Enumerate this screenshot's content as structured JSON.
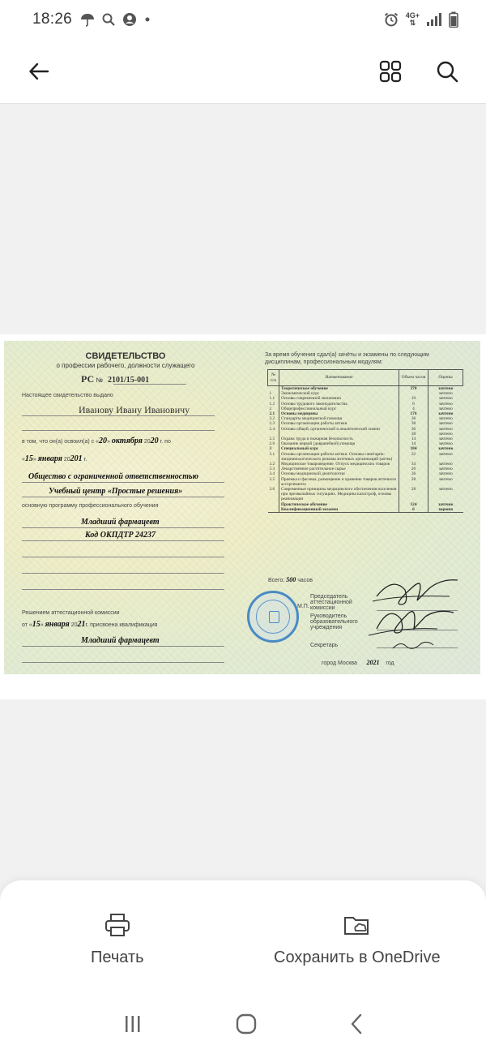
{
  "status": {
    "time": "18:26",
    "network": "4G+"
  },
  "app_bar": {
    "back_label": "back",
    "grid_label": "pages",
    "search_label": "search"
  },
  "certificate": {
    "title": "СВИДЕТЕЛЬСТВО",
    "subtitle": "о профессии рабочего, должности служащего",
    "rc_prefix": "РС",
    "rc_no": "№",
    "number": "2101/15-001",
    "issued_label": "Настоящее свидетельство выдано",
    "holder": "Иванову Ивану Ивановичу",
    "from_label": "в том, что он(а) освоил(а) с",
    "from_day": "20",
    "from_month": "октября",
    "year_prefix": "20",
    "from_year": "20",
    "g_by": "г. по",
    "to_day": "15",
    "to_month": "января",
    "to_year": "201",
    "g": "г.",
    "org_line1": "Общество с ограниченной ответственностью",
    "org_line2": "Учебный центр «Простые решения»",
    "program_label": "основную программу профессионального обучения",
    "program": "Младший фармацевт",
    "okpdtr": "Код ОКПДТР 24237",
    "commission_label": "Решением аттестационной комиссии",
    "from_word": "от",
    "c_day": "15",
    "c_month": "января",
    "c_year": "21",
    "assigned_label": "присвоена квалификация",
    "qualification": "Младший фармацевт",
    "table_intro": "За время обучения сдал(а) зачёты и экзамены по следующим дисциплинам, профессиональным модулям:",
    "col_no": "№ п/п",
    "col_name": "Наименование",
    "col_hours": "Объем часов",
    "col_grade": "Оценка",
    "rows": [
      {
        "n": "",
        "name": "Теоретическое обучение",
        "h": "370",
        "g": "зачтено",
        "b": true
      },
      {
        "n": "1",
        "name": "Экономический курс",
        "h": "",
        "g": "зачтено"
      },
      {
        "n": "1.1",
        "name": "Основы современной экономики",
        "h": "10",
        "g": "зачтено"
      },
      {
        "n": "1.2",
        "name": "Основы трудового законодательства",
        "h": "6",
        "g": "зачтено"
      },
      {
        "n": "2",
        "name": "Общепрофессиональный курс",
        "h": "4",
        "g": "зачтено"
      },
      {
        "n": "2.1",
        "name": "Основы медицины",
        "h": "176",
        "g": "зачтено",
        "b": true
      },
      {
        "n": "2.2",
        "name": "Стандарты медицинской помощи",
        "h": "36",
        "g": "зачтено"
      },
      {
        "n": "2.3",
        "name": "Основы организации работы аптеки",
        "h": "38",
        "g": "зачтено"
      },
      {
        "n": "2.4",
        "name": "Основы общей, органической и аналитической химии",
        "h": "36",
        "g": "зачтено"
      },
      {
        "n": "",
        "name": "",
        "h": "38",
        "g": "зачтено"
      },
      {
        "n": "2.5",
        "name": "Охрана труда и пожарная безопасность",
        "h": "14",
        "g": "зачтено"
      },
      {
        "n": "2.6",
        "name": "Оказание первой (доврачебной) помощи",
        "h": "14",
        "g": "зачтено"
      },
      {
        "n": "3",
        "name": "Специальный курс",
        "h": "184",
        "g": "зачтено",
        "b": true
      },
      {
        "n": "3.1",
        "name": "Основы организации работы аптеки. Основы санитарно-эпидемиологического режима аптечных организаций (аптек)",
        "h": "32",
        "g": "зачтено"
      },
      {
        "n": "3.2",
        "name": "Медицинское товароведение. Отпуск медицинских товаров",
        "h": "34",
        "g": "зачтено"
      },
      {
        "n": "3.3",
        "name": "Лекарственное растительное сырье",
        "h": "26",
        "g": "зачтено"
      },
      {
        "n": "3.4",
        "name": "Основы медицинской деонтологии",
        "h": "36",
        "g": "зачтено"
      },
      {
        "n": "3.5",
        "name": "Приемка и фасовка, размещение и хранение товаров аптечного ассортимента",
        "h": "28",
        "g": "зачтено"
      },
      {
        "n": "3.6",
        "name": "Современные принципы медицинского обеспечения населения при чрезвычайных ситуациях. Медицина катастроф, основы реанимации",
        "h": "28",
        "g": "зачтено"
      },
      {
        "n": "",
        "name": "Практическое обучение",
        "h": "124",
        "g": "зачтено",
        "b": true
      },
      {
        "n": "",
        "name": "Квалификационный экзамен",
        "h": "6",
        "g": "хорошо",
        "b": true
      }
    ],
    "total_label": "Всего:",
    "total_hours": "500",
    "hours_word": "часов",
    "chair_label": "Председатель аттестационной комиссии",
    "head_label": "Руководитель образовательного учреждения",
    "secretary_label": "Секретарь",
    "mp": "М.П.",
    "city_label": "город Москва",
    "issue_year": "2021",
    "year_word": "год"
  },
  "sheet": {
    "print": "Печать",
    "save_onedrive": "Сохранить в OneDrive"
  },
  "colors": {
    "accent": "#222222",
    "seal": "#4a8ac4"
  }
}
